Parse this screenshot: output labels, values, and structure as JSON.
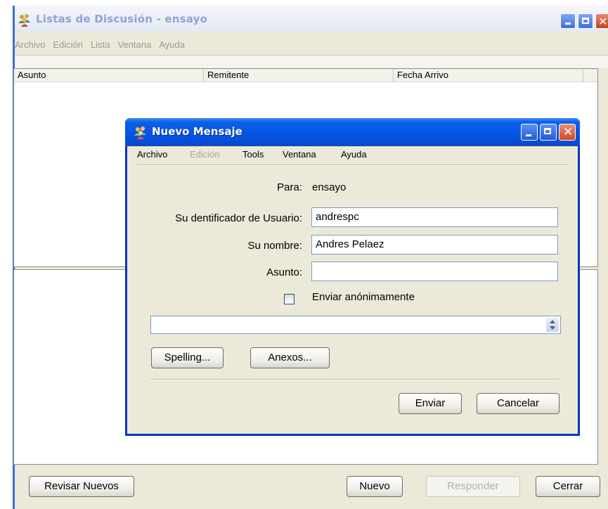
{
  "main": {
    "title": "Listas de Discusión - ensayo",
    "menu": [
      "Archivo",
      "Edición",
      "Lista",
      "Ventana",
      "Ayuda"
    ],
    "table_headers": [
      "Asunto",
      "Remitente",
      "Fecha Arrivo"
    ],
    "buttons": {
      "revisar": "Revisar Nuevos",
      "nuevo": "Nuevo",
      "responder": "Responder",
      "cerrar": "Cerrar"
    }
  },
  "dialog": {
    "title": "Nuevo Mensaje",
    "menu": {
      "archivo": "Archivo",
      "edicion": "Edición",
      "tools": "Tools",
      "ventana": "Ventana",
      "ayuda": "Ayuda"
    },
    "form": {
      "para_label": "Para:",
      "para_value": "ensayo",
      "user_id_label": "Su dentificador de Usuario:",
      "user_id_value": "andrespc",
      "name_label": "Su nombre:",
      "name_value": "Andres Pelaez",
      "subject_label": "Asunto:",
      "subject_value": "",
      "anon_label": "Enviar anónimamente",
      "anon_checked": false
    },
    "buttons": {
      "spelling": "Spelling...",
      "anexos": "Anexos...",
      "enviar": "Enviar",
      "cancelar": "Cancelar"
    }
  }
}
